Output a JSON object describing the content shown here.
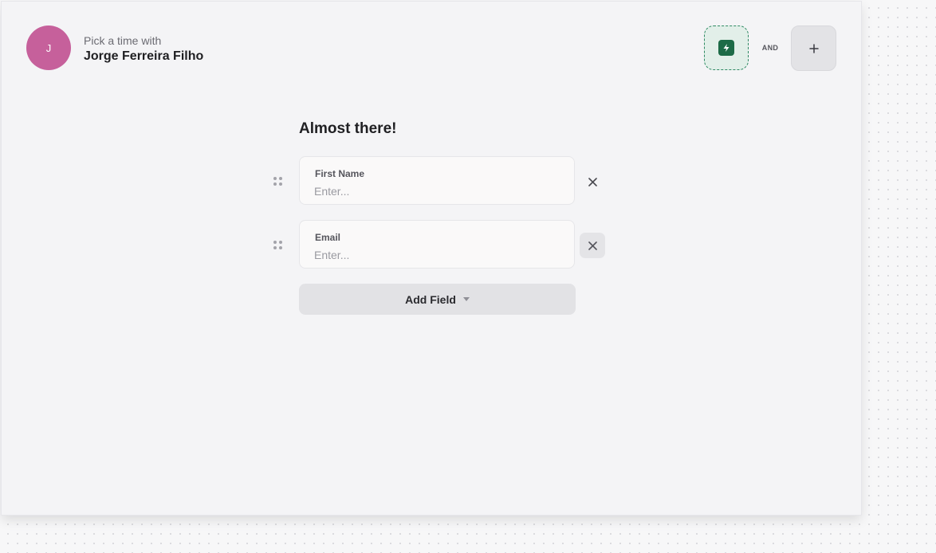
{
  "header": {
    "avatar_initial": "J",
    "subtitle": "Pick a time with",
    "host_name": "Jorge Ferreira Filho",
    "integration_icon": "lightning-bolt-icon",
    "connector_label": "AND",
    "add_integration_icon": "plus-icon",
    "avatar_color": "#c6609b",
    "integration_color": "#1d6b47"
  },
  "form": {
    "title": "Almost there!",
    "fields": [
      {
        "label": "First Name",
        "placeholder": "Enter...",
        "value": ""
      },
      {
        "label": "Email",
        "placeholder": "Enter...",
        "value": ""
      }
    ],
    "add_field_label": "Add Field"
  }
}
